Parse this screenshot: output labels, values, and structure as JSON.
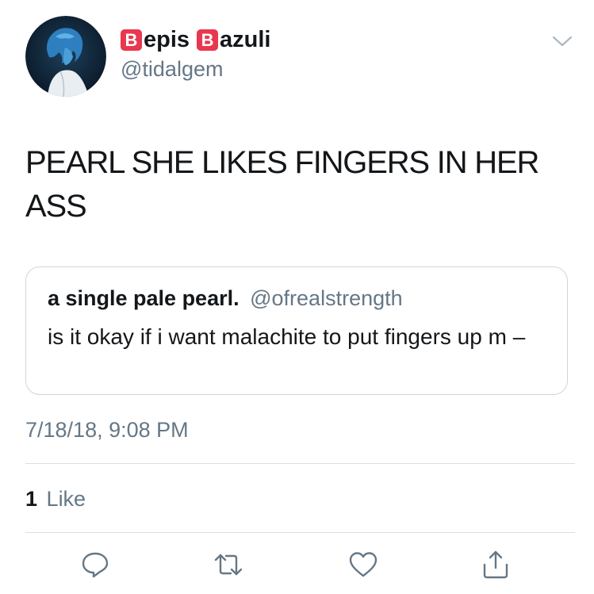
{
  "author": {
    "name_parts": [
      {
        "emoji": "B",
        "text": "epis"
      },
      {
        "emoji": "B",
        "text": "azuli"
      }
    ],
    "handle": "@tidalgem",
    "avatar_icon": "avatar-blue-hair-icon"
  },
  "tweet": {
    "text": "PEARL SHE LIKES FINGERS IN HER ASS"
  },
  "quoted_tweet": {
    "name": "a single pale pearl.",
    "handle": "@ofrealstrength",
    "text": "is it okay if i want malachite to put fingers up m –"
  },
  "timestamp": "7/18/18, 9:08 PM",
  "stats": {
    "likes_count": "1",
    "likes_label": "Like"
  },
  "actions": [
    {
      "icon": "reply-icon"
    },
    {
      "icon": "retweet-icon"
    },
    {
      "icon": "like-heart-icon"
    },
    {
      "icon": "share-icon"
    }
  ],
  "colors": {
    "emoji_bg": "#e8384f",
    "secondary_text": "#657786",
    "border": "#ccd6dd"
  }
}
